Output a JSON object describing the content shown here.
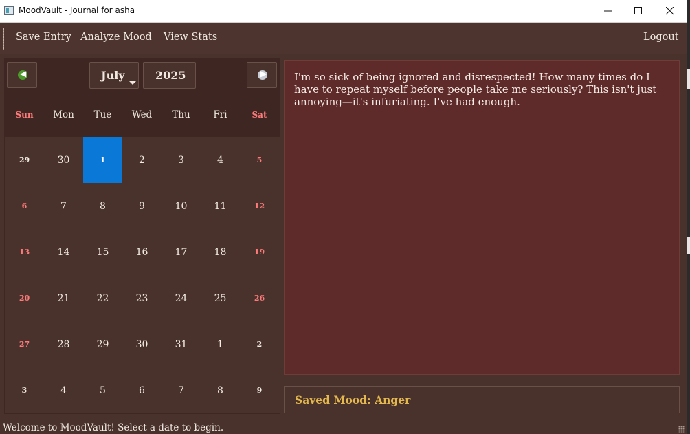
{
  "window": {
    "title": "MoodVault - Journal for asha",
    "icons": {
      "app": "app-window-icon",
      "minimize": "minimize-icon",
      "maximize": "maximize-icon",
      "close": "close-icon"
    }
  },
  "toolbar": {
    "save_label": "Save Entry",
    "analyze_label": "Analyze Mood",
    "stats_label": "View Stats",
    "logout_label": "Logout"
  },
  "calendar": {
    "month": "July",
    "year": "2025",
    "prev_icon": "arrow-left-icon",
    "next_icon": "arrow-right-icon",
    "weekdays": [
      "Sun",
      "Mon",
      "Tue",
      "Wed",
      "Thu",
      "Fri",
      "Sat"
    ],
    "weeks": [
      [
        "29",
        "30",
        "1",
        "2",
        "3",
        "4",
        "5"
      ],
      [
        "6",
        "7",
        "8",
        "9",
        "10",
        "11",
        "12"
      ],
      [
        "13",
        "14",
        "15",
        "16",
        "17",
        "18",
        "19"
      ],
      [
        "20",
        "21",
        "22",
        "23",
        "24",
        "25",
        "26"
      ],
      [
        "27",
        "28",
        "29",
        "30",
        "31",
        "1",
        "2"
      ],
      [
        "3",
        "4",
        "5",
        "6",
        "7",
        "8",
        "9"
      ]
    ],
    "selected_day": "1",
    "colors": {
      "weekend": "#ff7b7b",
      "selected": "#0a78d7"
    }
  },
  "journal": {
    "text": "I'm so sick of being ignored and disrespected! How many times do I have to repeat myself before people take me seriously? This isn't just annoying—it's infuriating. I've had enough."
  },
  "mood": {
    "label": "Saved Mood: Anger",
    "color": "#e3b84f"
  },
  "status": {
    "message": "Welcome to MoodVault! Select a date to begin."
  }
}
